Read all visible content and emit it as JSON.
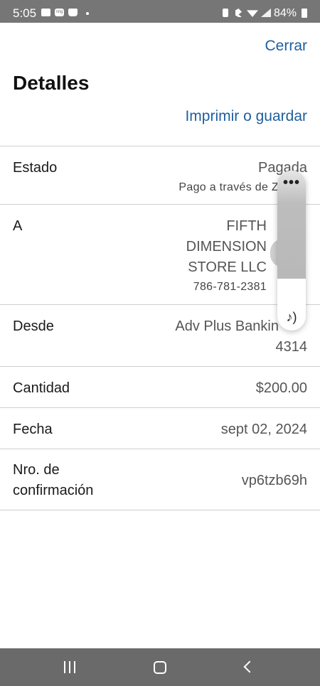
{
  "status_bar": {
    "time": "5:05",
    "battery": "84%",
    "left_icons": [
      "mail-icon",
      "ring-icon",
      "shopping-bag-icon",
      "dot-icon"
    ],
    "right_icons": [
      "vibrate-icon",
      "bluetooth-icon",
      "wifi-icon",
      "signal-icon",
      "battery-icon"
    ]
  },
  "header": {
    "close_label": "Cerrar",
    "title": "Detalles",
    "print_label": "Imprimir o guardar"
  },
  "details": {
    "status": {
      "label": "Estado",
      "value": "Pagada",
      "sub": "Pago a través de Z"
    },
    "to": {
      "label": "A",
      "name_lines": [
        "FIFTH",
        "DIMENSION",
        "STORE LLC"
      ],
      "phone": "786-781-2381"
    },
    "from": {
      "label": "Desde",
      "line1": "Adv Plus Bankin",
      "line2": "4314"
    },
    "amount": {
      "label": "Cantidad",
      "value": "$200.00"
    },
    "date": {
      "label": "Fecha",
      "value": "sept 02, 2024"
    },
    "confirmation": {
      "label_line1": "Nro. de",
      "label_line2": "confirmación",
      "value": "vp6tzb69h"
    }
  },
  "overlay": {
    "more_label": "•••",
    "music_icon": "music-note-icon"
  },
  "nav_bar": {
    "icons": [
      "recent-apps-icon",
      "home-icon",
      "back-icon"
    ]
  },
  "colors": {
    "link": "#1f5f9e",
    "status_bar": "#767676",
    "nav_bar": "#6a6a6a",
    "divider": "#cfcfcf"
  }
}
